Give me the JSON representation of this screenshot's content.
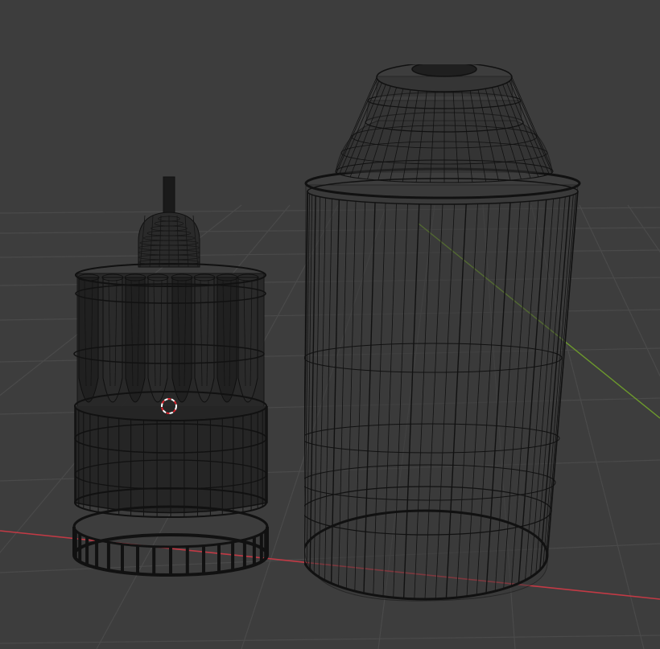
{
  "viewport": {
    "shading_mode": "wireframe",
    "background_color": "#3d3d3d",
    "grid_color": "#4a4a4a",
    "x_axis_color": "#c23a45",
    "y_axis_color": "#6d9a2c",
    "wire_color": "#111111",
    "cursor_colors": [
      "#ffffff",
      "#d9252f"
    ]
  },
  "objects": [
    {
      "name": "spray-nozzle-assembly",
      "type": "mesh",
      "display": "wireframe"
    },
    {
      "name": "spray-can-body",
      "type": "mesh",
      "display": "wireframe"
    }
  ],
  "cursor": {
    "name": "3d-cursor-icon"
  }
}
